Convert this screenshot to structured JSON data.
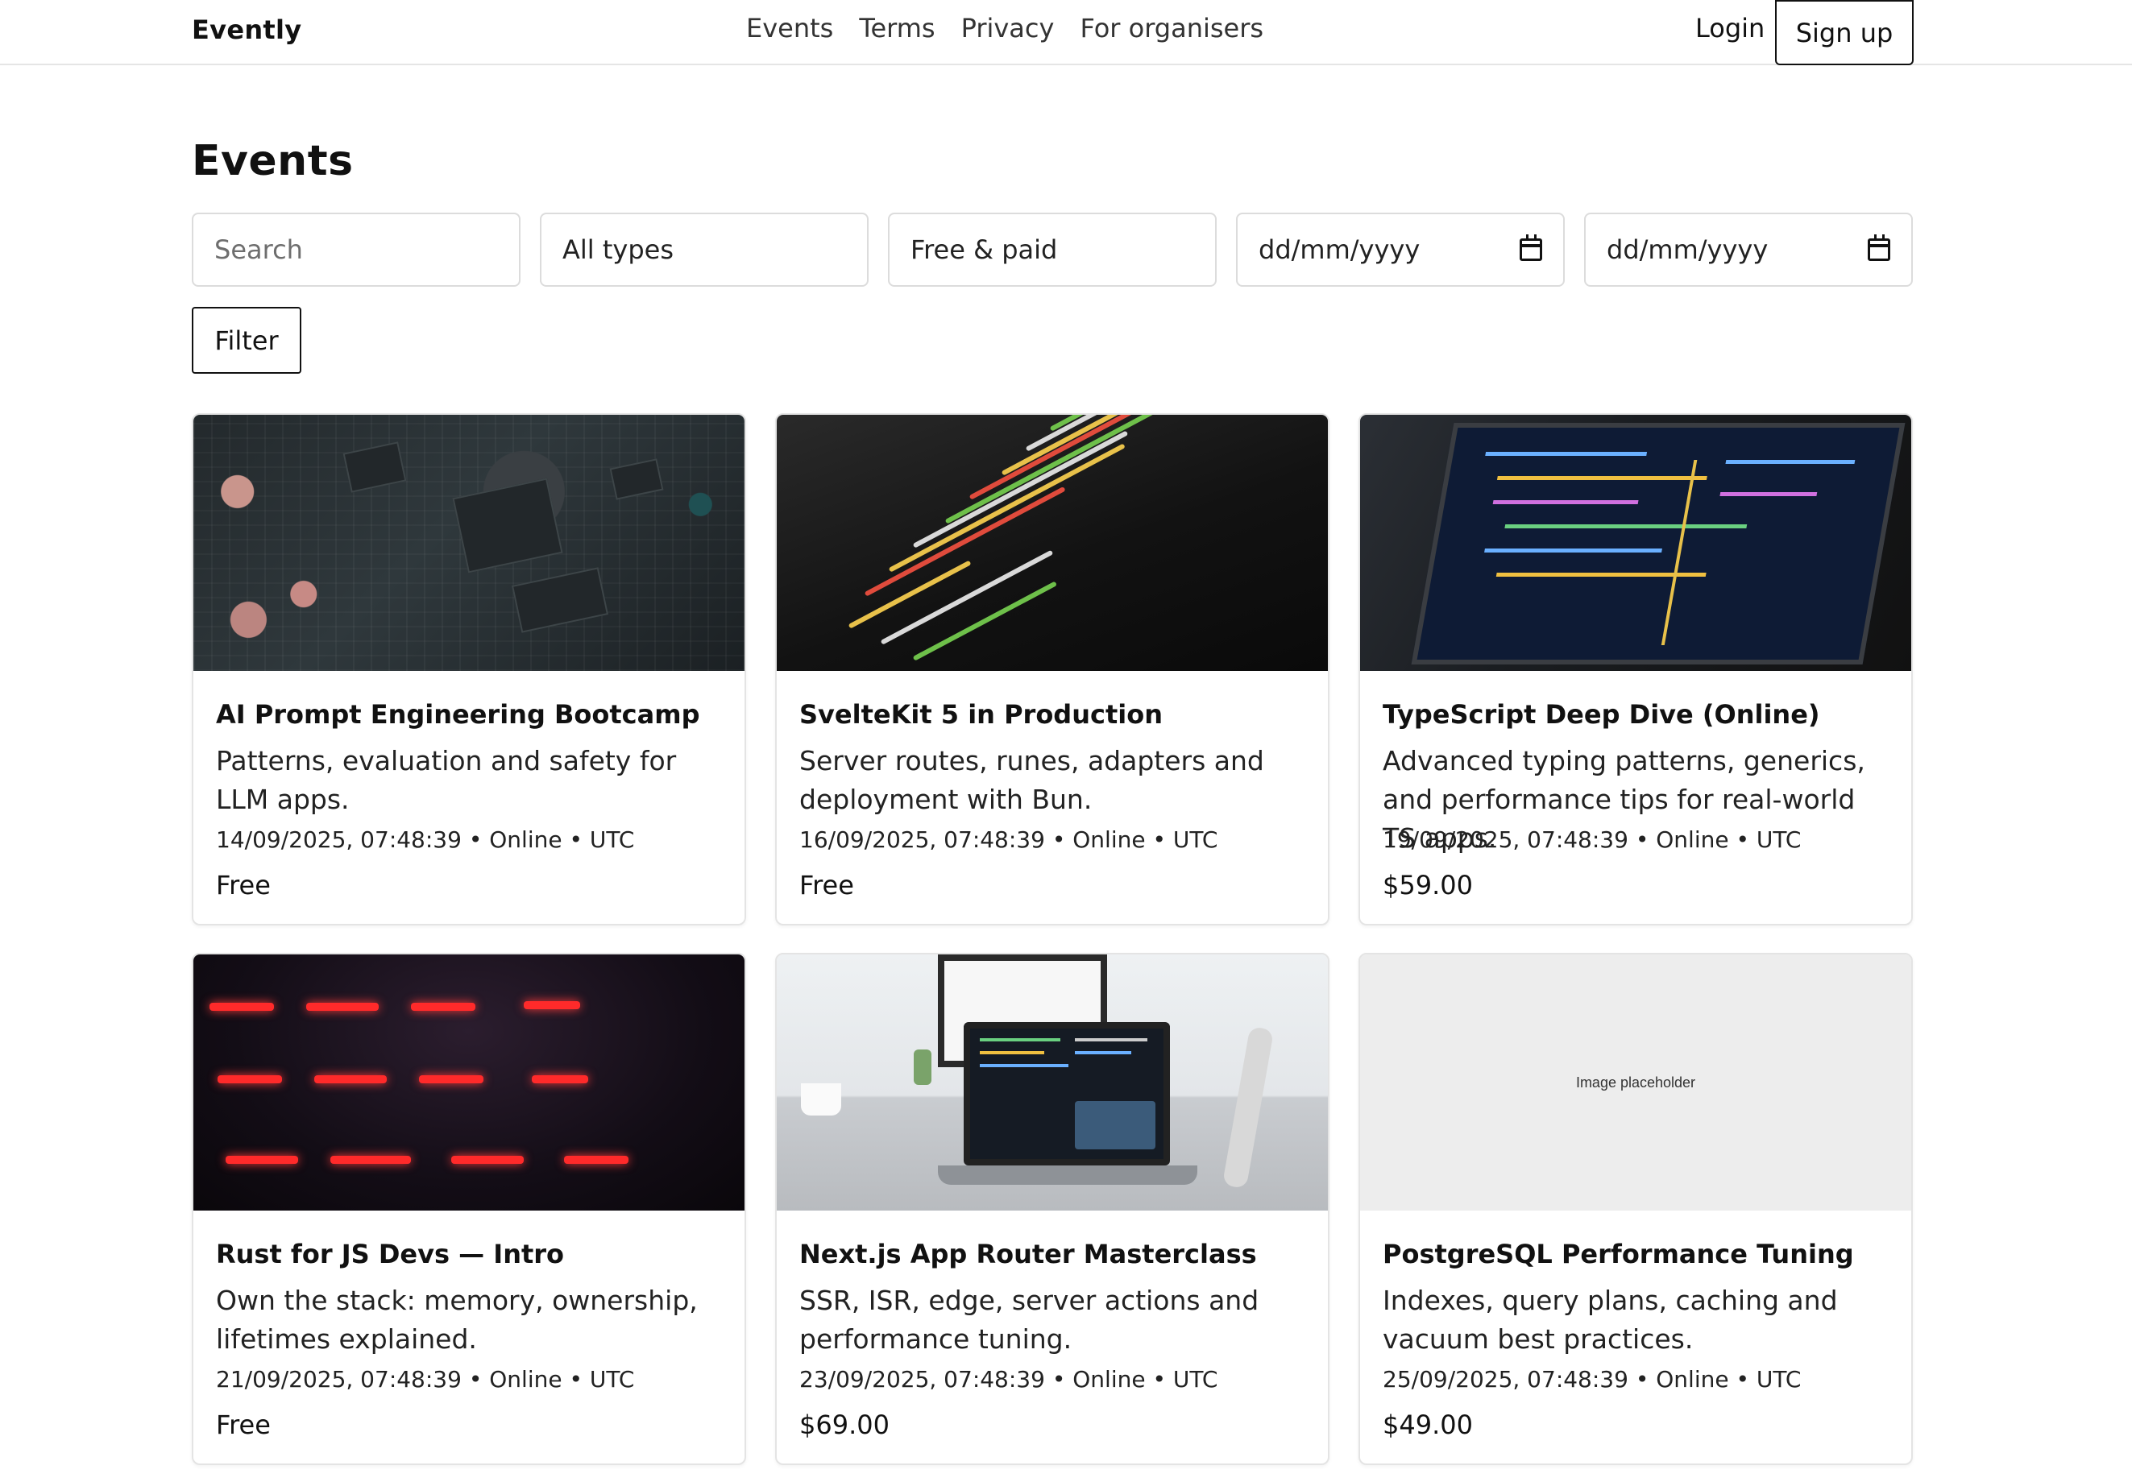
{
  "header": {
    "brand": "Evently",
    "nav": [
      "Events",
      "Terms",
      "Privacy",
      "For organisers"
    ],
    "login": "Login",
    "signup": "Sign up"
  },
  "page": {
    "title": "Events"
  },
  "filters": {
    "search_placeholder": "Search",
    "type_selected": "All types",
    "price_selected": "Free & paid",
    "date_from_placeholder": "dd/mm/yyyy",
    "date_to_placeholder": "dd/mm/yyyy",
    "filter_button": "Filter"
  },
  "events": [
    {
      "title": "AI Prompt Engineering Bootcamp",
      "description": "Patterns, evaluation and safety for LLM apps.",
      "meta": "14/09/2025, 07:48:39 • Online • UTC",
      "price": "Free",
      "image": "circuit-board"
    },
    {
      "title": "SvelteKit 5 in Production",
      "description": "Server routes, runes, adapters and deployment with Bun.",
      "meta": "16/09/2025, 07:48:39 • Online • UTC",
      "price": "Free",
      "image": "code-screen"
    },
    {
      "title": "TypeScript Deep Dive (Online)",
      "description": "Advanced typing patterns, generics, and performance tips for real-world TS apps.",
      "meta": "19/09/2025, 07:48:39 • Online • UTC",
      "price": "$59.00",
      "image": "laptop-code"
    },
    {
      "title": "Rust for JS Devs — Intro",
      "description": "Own the stack: memory, ownership, lifetimes explained.",
      "meta": "21/09/2025, 07:48:39 • Online • UTC",
      "price": "Free",
      "image": "red-keyboard"
    },
    {
      "title": "Next.js App Router Masterclass",
      "description": "SSR, ISR, edge, server actions and performance tuning.",
      "meta": "23/09/2025, 07:48:39 • Online • UTC",
      "price": "$69.00",
      "image": "desk-laptop"
    },
    {
      "title": "PostgreSQL Performance Tuning",
      "description": "Indexes, query plans, caching and vacuum best practices.",
      "meta": "25/09/2025, 07:48:39 • Online • UTC",
      "price": "$49.00",
      "image": "placeholder",
      "image_label": "Image placeholder"
    }
  ]
}
